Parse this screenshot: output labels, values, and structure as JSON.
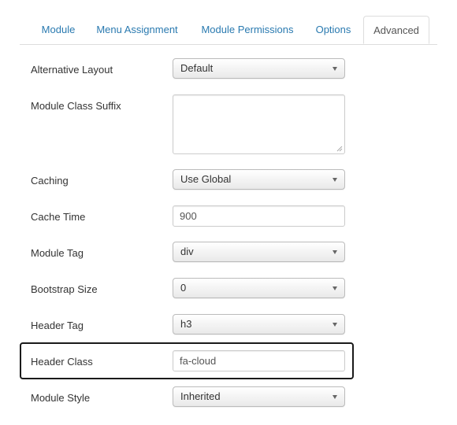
{
  "tabs": [
    {
      "label": "Module",
      "active": false
    },
    {
      "label": "Menu Assignment",
      "active": false
    },
    {
      "label": "Module Permissions",
      "active": false
    },
    {
      "label": "Options",
      "active": false
    },
    {
      "label": "Advanced",
      "active": true
    }
  ],
  "fields": {
    "alternative_layout": {
      "label": "Alternative Layout",
      "value": "Default"
    },
    "module_class_suffix": {
      "label": "Module Class Suffix",
      "value": ""
    },
    "caching": {
      "label": "Caching",
      "value": "Use Global"
    },
    "cache_time": {
      "label": "Cache Time",
      "value": "900"
    },
    "module_tag": {
      "label": "Module Tag",
      "value": "div"
    },
    "bootstrap_size": {
      "label": "Bootstrap Size",
      "value": "0"
    },
    "header_tag": {
      "label": "Header Tag",
      "value": "h3"
    },
    "header_class": {
      "label": "Header Class",
      "value": "fa-cloud",
      "highlighted": true
    },
    "module_style": {
      "label": "Module Style",
      "value": "Inherited"
    }
  },
  "colors": {
    "link": "#2a7ab0",
    "highlight_border": "#1a1a1a"
  },
  "icons": {
    "dropdown": "chevron-down-icon",
    "resize": "resize-grip-icon"
  }
}
